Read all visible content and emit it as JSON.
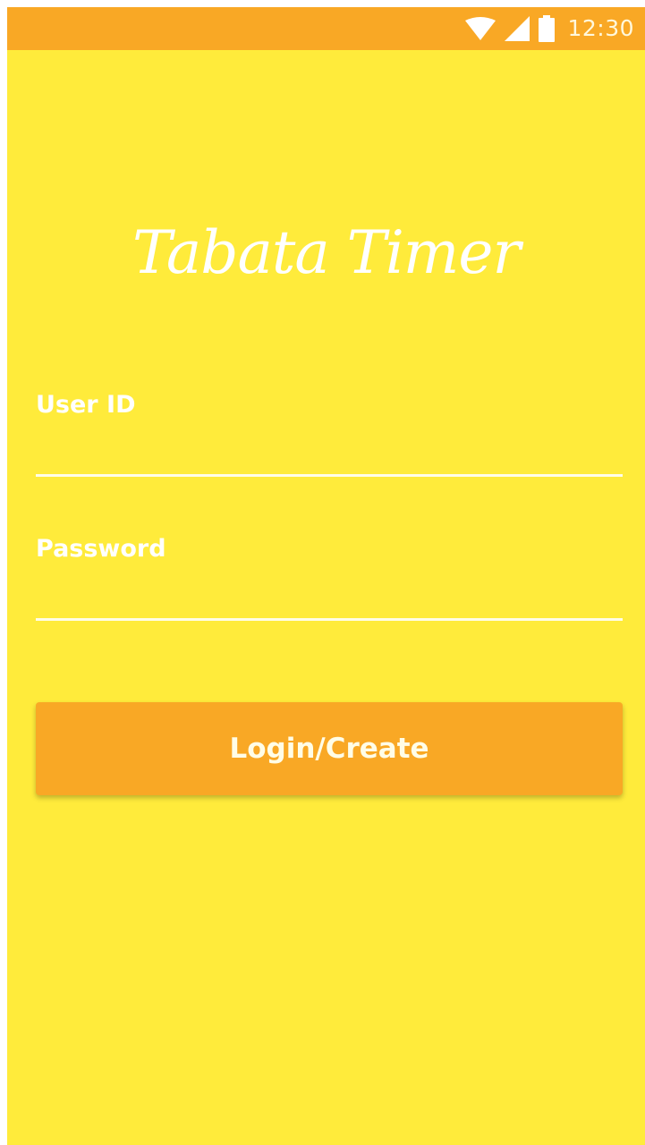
{
  "status_bar": {
    "time": "12:30",
    "icons": [
      "wifi-icon",
      "cell-signal-icon",
      "battery-icon"
    ]
  },
  "app": {
    "title": "Tabata Timer"
  },
  "form": {
    "user_id": {
      "label": "User ID",
      "value": "",
      "placeholder": ""
    },
    "password": {
      "label": "Password",
      "value": "",
      "placeholder": ""
    },
    "submit_label": "Login/Create"
  },
  "colors": {
    "background": "#ffeb3b",
    "accent": "#f9a825",
    "text": "#ffffff"
  }
}
